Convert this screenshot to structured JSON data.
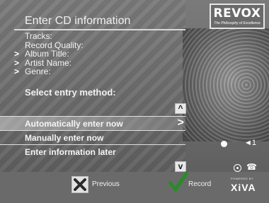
{
  "header": {
    "title": "Enter CD information"
  },
  "brand": {
    "logo": "REVOX",
    "tagline": "The Philosophy of Excellence"
  },
  "fields": [
    {
      "label": "Tracks:",
      "has_arrow": false
    },
    {
      "label": "Record Quality:",
      "has_arrow": false
    },
    {
      "label": "Album Title:",
      "has_arrow": true
    },
    {
      "label": "Artist Name:",
      "has_arrow": true
    },
    {
      "label": "Genre:",
      "has_arrow": true
    }
  ],
  "chevron": ">",
  "select_label": "Select entry method:",
  "options": [
    {
      "label": "Automatically enter now",
      "selected": true
    },
    {
      "label": "Manually enter now",
      "selected": false
    },
    {
      "label": "Enter information later",
      "selected": false
    }
  ],
  "footer": {
    "previous_label": "Previous",
    "record_label": "Record",
    "powered_by": "POWERED BY",
    "xiva": "XiVA"
  },
  "colors": {
    "accent_green": "#2a8a2a",
    "selected_row": "#c8c8c8",
    "background": "#6e6e6e"
  },
  "icons": {
    "up": "^",
    "down": "v",
    "speaker": "◄1",
    "phone": "☎"
  }
}
